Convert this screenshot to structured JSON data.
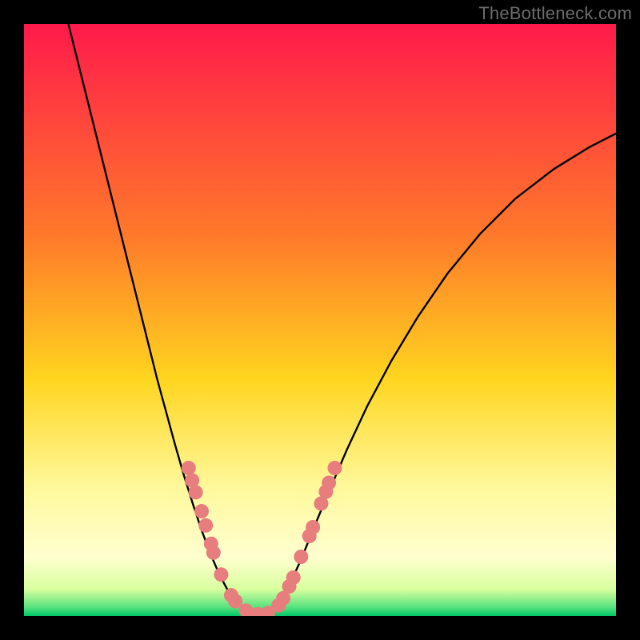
{
  "watermark": "TheBottleneck.com",
  "chart_data": {
    "type": "line",
    "title": "",
    "xlabel": "",
    "ylabel": "",
    "xlim": [
      0,
      1
    ],
    "ylim": [
      0,
      1
    ],
    "background_gradient": {
      "stops": [
        {
          "offset": 0.0,
          "color": "#ff1a4b"
        },
        {
          "offset": 0.36,
          "color": "#ff7a2a"
        },
        {
          "offset": 0.6,
          "color": "#ffd51f"
        },
        {
          "offset": 0.78,
          "color": "#fff89a"
        },
        {
          "offset": 0.9,
          "color": "#ffffcf"
        },
        {
          "offset": 0.955,
          "color": "#d8ff9e"
        },
        {
          "offset": 0.985,
          "color": "#58e27e"
        },
        {
          "offset": 1.0,
          "color": "#00c86a"
        }
      ]
    },
    "series": [
      {
        "name": "left-curve",
        "color": "#000000",
        "width": 2.4,
        "values": [
          {
            "x": 0.075,
            "y": 1.0
          },
          {
            "x": 0.09,
            "y": 0.94
          },
          {
            "x": 0.105,
            "y": 0.88
          },
          {
            "x": 0.12,
            "y": 0.82
          },
          {
            "x": 0.135,
            "y": 0.76
          },
          {
            "x": 0.15,
            "y": 0.7
          },
          {
            "x": 0.165,
            "y": 0.64
          },
          {
            "x": 0.18,
            "y": 0.58
          },
          {
            "x": 0.195,
            "y": 0.52
          },
          {
            "x": 0.21,
            "y": 0.46
          },
          {
            "x": 0.225,
            "y": 0.4
          },
          {
            "x": 0.24,
            "y": 0.345
          },
          {
            "x": 0.255,
            "y": 0.29
          },
          {
            "x": 0.27,
            "y": 0.238
          },
          {
            "x": 0.285,
            "y": 0.19
          },
          {
            "x": 0.3,
            "y": 0.145
          },
          {
            "x": 0.315,
            "y": 0.105
          },
          {
            "x": 0.33,
            "y": 0.07
          },
          {
            "x": 0.345,
            "y": 0.042
          },
          {
            "x": 0.36,
            "y": 0.022
          },
          {
            "x": 0.375,
            "y": 0.01
          },
          {
            "x": 0.39,
            "y": 0.004
          },
          {
            "x": 0.405,
            "y": 0.002
          }
        ]
      },
      {
        "name": "right-curve",
        "color": "#000000",
        "width": 2.4,
        "values": [
          {
            "x": 0.405,
            "y": 0.002
          },
          {
            "x": 0.42,
            "y": 0.01
          },
          {
            "x": 0.435,
            "y": 0.028
          },
          {
            "x": 0.452,
            "y": 0.06
          },
          {
            "x": 0.47,
            "y": 0.1
          },
          {
            "x": 0.49,
            "y": 0.15
          },
          {
            "x": 0.515,
            "y": 0.21
          },
          {
            "x": 0.545,
            "y": 0.28
          },
          {
            "x": 0.58,
            "y": 0.355
          },
          {
            "x": 0.62,
            "y": 0.43
          },
          {
            "x": 0.665,
            "y": 0.505
          },
          {
            "x": 0.715,
            "y": 0.578
          },
          {
            "x": 0.77,
            "y": 0.645
          },
          {
            "x": 0.83,
            "y": 0.705
          },
          {
            "x": 0.895,
            "y": 0.755
          },
          {
            "x": 0.955,
            "y": 0.792
          },
          {
            "x": 1.0,
            "y": 0.815
          }
        ]
      }
    ],
    "markers": {
      "color": "#e87d7d",
      "radius": 9,
      "points": [
        {
          "x": 0.278,
          "y": 0.25
        },
        {
          "x": 0.284,
          "y": 0.229
        },
        {
          "x": 0.29,
          "y": 0.209
        },
        {
          "x": 0.3,
          "y": 0.177
        },
        {
          "x": 0.307,
          "y": 0.153
        },
        {
          "x": 0.316,
          "y": 0.122
        },
        {
          "x": 0.32,
          "y": 0.107
        },
        {
          "x": 0.333,
          "y": 0.07
        },
        {
          "x": 0.35,
          "y": 0.035
        },
        {
          "x": 0.357,
          "y": 0.025
        },
        {
          "x": 0.375,
          "y": 0.009
        },
        {
          "x": 0.395,
          "y": 0.003
        },
        {
          "x": 0.412,
          "y": 0.005
        },
        {
          "x": 0.43,
          "y": 0.018
        },
        {
          "x": 0.438,
          "y": 0.03
        },
        {
          "x": 0.448,
          "y": 0.05
        },
        {
          "x": 0.455,
          "y": 0.065
        },
        {
          "x": 0.468,
          "y": 0.1
        },
        {
          "x": 0.482,
          "y": 0.135
        },
        {
          "x": 0.488,
          "y": 0.15
        },
        {
          "x": 0.502,
          "y": 0.19
        },
        {
          "x": 0.51,
          "y": 0.21
        },
        {
          "x": 0.515,
          "y": 0.225
        },
        {
          "x": 0.525,
          "y": 0.25
        }
      ]
    }
  }
}
